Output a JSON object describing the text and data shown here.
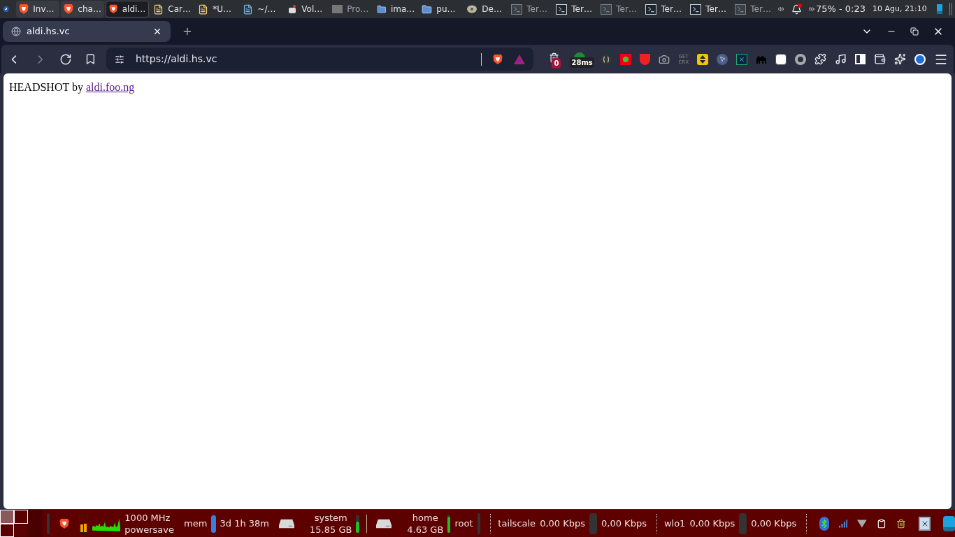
{
  "top_panel": {
    "tasks": [
      {
        "label": "Inv…",
        "kind": "browser",
        "selected": false,
        "minimized": false
      },
      {
        "label": "cha…",
        "kind": "browser",
        "selected": false,
        "minimized": false
      },
      {
        "label": "aldi…",
        "kind": "browser",
        "selected": true,
        "minimized": false
      },
      {
        "label": "Car…",
        "kind": "note",
        "selected": false,
        "minimized": false
      },
      {
        "label": "*U…",
        "kind": "note",
        "selected": false,
        "minimized": false
      },
      {
        "label": "~/…",
        "kind": "editor",
        "selected": false,
        "minimized": false
      },
      {
        "label": "Vol…",
        "kind": "app",
        "selected": false,
        "minimized": false
      },
      {
        "label": "Pro…",
        "kind": "window",
        "selected": false,
        "minimized": true
      },
      {
        "label": "ima…",
        "kind": "folder",
        "selected": false,
        "minimized": false
      },
      {
        "label": "pu…",
        "kind": "folder",
        "selected": false,
        "minimized": false
      },
      {
        "label": "De…",
        "kind": "disc",
        "selected": false,
        "minimized": false
      },
      {
        "label": "Ter…",
        "kind": "terminal",
        "selected": false,
        "minimized": true
      },
      {
        "label": "Ter…",
        "kind": "terminal",
        "selected": false,
        "minimized": false
      },
      {
        "label": "Ter…",
        "kind": "terminal",
        "selected": false,
        "minimized": true
      },
      {
        "label": "Ter…",
        "kind": "terminal",
        "selected": false,
        "minimized": false
      },
      {
        "label": "Ter…",
        "kind": "terminal",
        "selected": false,
        "minimized": false
      },
      {
        "label": "Ter…",
        "kind": "terminal",
        "selected": false,
        "minimized": true
      }
    ],
    "battery": "75% - 0:23",
    "clock": "10 Agu, 21:10"
  },
  "browser": {
    "tabs": [
      {
        "title": "aldi.hs.vc",
        "selected": true
      }
    ],
    "address": "https://aldi.hs.vc",
    "extension_badges": {
      "counter": "0",
      "ping": "28ms",
      "crx_top": "GET",
      "crx_bottom": "CRX"
    },
    "page": {
      "text": "HEADSHOT by",
      "link": "aldi.foo.ng"
    }
  },
  "bottom_panel": {
    "desktops": [
      {
        "selected": true,
        "occupied": true
      },
      {
        "selected": false,
        "occupied": true
      },
      {
        "selected": false,
        "occupied": false
      },
      {
        "selected": false,
        "occupied": true
      },
      {
        "selected": false,
        "occupied": false
      },
      {
        "selected": false,
        "occupied": false
      }
    ],
    "cpu_cores": [
      {
        "level": 0.45
      },
      {
        "level": 0.5
      }
    ],
    "cpu_freq": "1000 MHz",
    "cpu_governor": "powersave",
    "mem_label": "mem",
    "mem": {
      "level": 0.95
    },
    "uptime": "3d 1h 38m",
    "disks": [
      {
        "name": "system",
        "size": "15.85 GB",
        "level": 0.6
      },
      {
        "name": "home",
        "size": "4.63 GB",
        "level": 0.85
      }
    ],
    "root_label": "root",
    "networks": [
      {
        "name": "tailscale",
        "down": "0,00 Kbps",
        "up": "0,00 Kbps"
      },
      {
        "name": "wlo1",
        "down": "0,00 Kbps",
        "up": "0,00 Kbps"
      }
    ]
  }
}
